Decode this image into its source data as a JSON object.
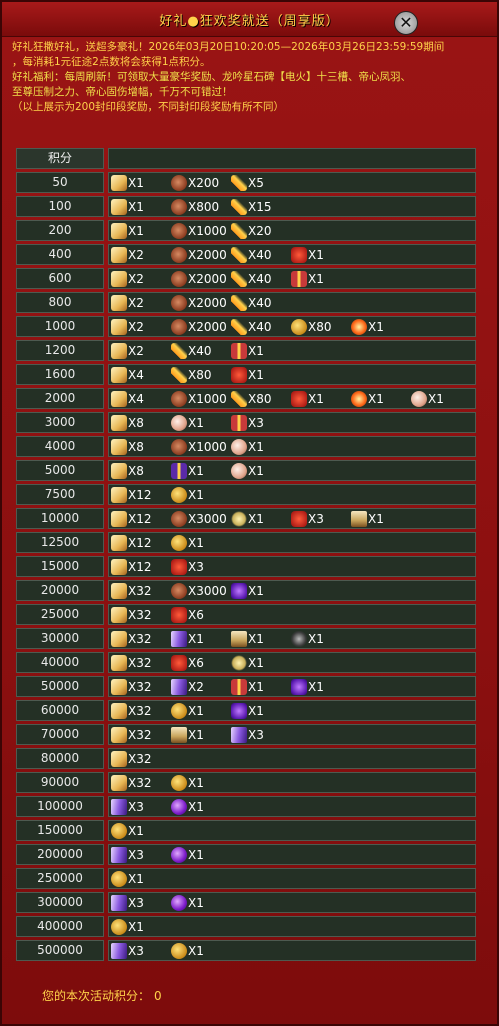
{
  "header": {
    "title": "好礼●狂欢奖就送（周享版）",
    "close_symbol": "✕"
  },
  "intro": {
    "line1": "好礼狂撒好礼，送超多豪礼！2026年03月20日10:20:05—2026年03月26日23:59:59期间",
    "line2": "，每消耗1元征途2点数将会获得1点积分。",
    "line3": "好礼福利：每周刷新！可领取大量豪华奖励、龙吟星石碑【电火】十三槽、帝心凤羽、",
    "line4": "至尊压制之力、帝心固伤增幅，千万不可错过！",
    "line5": "（以上展示为200封印段奖励，不同封印段奖励有所不同）"
  },
  "table": {
    "header": "积分",
    "rows": [
      {
        "score": "50",
        "items": [
          {
            "icon": "scroll-icon",
            "qty": "X1"
          },
          {
            "icon": "stone-icon",
            "qty": "X200"
          },
          {
            "icon": "feather-icon",
            "qty": "X5"
          }
        ]
      },
      {
        "score": "100",
        "items": [
          {
            "icon": "scroll-icon",
            "qty": "X1"
          },
          {
            "icon": "stone-icon",
            "qty": "X800"
          },
          {
            "icon": "feather-icon",
            "qty": "X15"
          }
        ]
      },
      {
        "score": "200",
        "items": [
          {
            "icon": "scroll-icon",
            "qty": "X1"
          },
          {
            "icon": "stone-icon",
            "qty": "X1000"
          },
          {
            "icon": "feather-icon",
            "qty": "X20"
          }
        ]
      },
      {
        "score": "400",
        "items": [
          {
            "icon": "scroll-icon",
            "qty": "X2"
          },
          {
            "icon": "stone-icon",
            "qty": "X2000"
          },
          {
            "icon": "feather-icon",
            "qty": "X40"
          },
          {
            "icon": "redbox-icon",
            "qty": "X1"
          }
        ]
      },
      {
        "score": "600",
        "items": [
          {
            "icon": "scroll-icon",
            "qty": "X2"
          },
          {
            "icon": "stone-icon",
            "qty": "X2000"
          },
          {
            "icon": "feather-icon",
            "qty": "X40"
          },
          {
            "icon": "giftbox-icon",
            "qty": "X1"
          }
        ]
      },
      {
        "score": "800",
        "items": [
          {
            "icon": "scroll-icon",
            "qty": "X2"
          },
          {
            "icon": "stone-icon",
            "qty": "X2000"
          },
          {
            "icon": "feather-icon",
            "qty": "X40"
          }
        ]
      },
      {
        "score": "1000",
        "items": [
          {
            "icon": "scroll-icon",
            "qty": "X2"
          },
          {
            "icon": "stone-icon",
            "qty": "X2000"
          },
          {
            "icon": "feather-icon",
            "qty": "X40"
          },
          {
            "icon": "coin-icon",
            "qty": "X80"
          },
          {
            "icon": "orb-icon",
            "qty": "X1"
          }
        ]
      },
      {
        "score": "1200",
        "items": [
          {
            "icon": "scroll-icon",
            "qty": "X2"
          },
          {
            "icon": "feather-icon",
            "qty": "X40"
          },
          {
            "icon": "giftbox-icon",
            "qty": "X1"
          }
        ]
      },
      {
        "score": "1600",
        "items": [
          {
            "icon": "scroll-icon",
            "qty": "X4"
          },
          {
            "icon": "feather-icon",
            "qty": "X80"
          },
          {
            "icon": "redbox-icon",
            "qty": "X1"
          }
        ]
      },
      {
        "score": "2000",
        "items": [
          {
            "icon": "scroll-icon",
            "qty": "X4"
          },
          {
            "icon": "stone-icon",
            "qty": "X1000"
          },
          {
            "icon": "feather-icon",
            "qty": "X80"
          },
          {
            "icon": "redbox-icon",
            "qty": "X1"
          },
          {
            "icon": "orb-icon",
            "qty": "X1"
          },
          {
            "icon": "pearl-icon",
            "qty": "X1"
          }
        ]
      },
      {
        "score": "3000",
        "items": [
          {
            "icon": "scroll-icon",
            "qty": "X8"
          },
          {
            "icon": "pearl-icon",
            "qty": "X1"
          },
          {
            "icon": "giftbox-icon",
            "qty": "X3"
          }
        ]
      },
      {
        "score": "4000",
        "items": [
          {
            "icon": "scroll-icon",
            "qty": "X8"
          },
          {
            "icon": "stone-icon",
            "qty": "X1000"
          },
          {
            "icon": "pearl-icon",
            "qty": "X1"
          }
        ]
      },
      {
        "score": "5000",
        "items": [
          {
            "icon": "scroll-icon",
            "qty": "X8"
          },
          {
            "icon": "purplegift-icon",
            "qty": "X1"
          },
          {
            "icon": "pearl-icon",
            "qty": "X1"
          }
        ]
      },
      {
        "score": "7500",
        "items": [
          {
            "icon": "scroll-icon",
            "qty": "X12"
          },
          {
            "icon": "coin-icon",
            "qty": "X1"
          }
        ]
      },
      {
        "score": "10000",
        "items": [
          {
            "icon": "scroll-icon",
            "qty": "X12"
          },
          {
            "icon": "stone-icon",
            "qty": "X3000"
          },
          {
            "icon": "star-icon",
            "qty": "X1"
          },
          {
            "icon": "redbox-icon",
            "qty": "X3"
          },
          {
            "icon": "chest-icon",
            "qty": "X1"
          }
        ]
      },
      {
        "score": "12500",
        "items": [
          {
            "icon": "scroll-icon",
            "qty": "X12"
          },
          {
            "icon": "coin-icon",
            "qty": "X1"
          }
        ]
      },
      {
        "score": "15000",
        "items": [
          {
            "icon": "scroll-icon",
            "qty": "X12"
          },
          {
            "icon": "redbox-icon",
            "qty": "X3"
          }
        ]
      },
      {
        "score": "20000",
        "items": [
          {
            "icon": "scroll-icon",
            "qty": "X32"
          },
          {
            "icon": "stone-icon",
            "qty": "X3000"
          },
          {
            "icon": "purplebox-icon",
            "qty": "X1"
          }
        ]
      },
      {
        "score": "25000",
        "items": [
          {
            "icon": "scroll-icon",
            "qty": "X32"
          },
          {
            "icon": "redbox-icon",
            "qty": "X6"
          }
        ]
      },
      {
        "score": "30000",
        "items": [
          {
            "icon": "scroll-icon",
            "qty": "X32"
          },
          {
            "icon": "talisman-icon",
            "qty": "X1"
          },
          {
            "icon": "chest-icon",
            "qty": "X1"
          },
          {
            "icon": "blackitem-icon",
            "qty": "X1"
          }
        ]
      },
      {
        "score": "40000",
        "items": [
          {
            "icon": "scroll-icon",
            "qty": "X32"
          },
          {
            "icon": "redbox-icon",
            "qty": "X6"
          },
          {
            "icon": "star-icon",
            "qty": "X1"
          }
        ]
      },
      {
        "score": "50000",
        "items": [
          {
            "icon": "scroll-icon",
            "qty": "X32"
          },
          {
            "icon": "talisman-icon",
            "qty": "X2"
          },
          {
            "icon": "giftbox-icon",
            "qty": "X1"
          },
          {
            "icon": "purplebox-icon",
            "qty": "X1"
          }
        ]
      },
      {
        "score": "60000",
        "items": [
          {
            "icon": "scroll-icon",
            "qty": "X32"
          },
          {
            "icon": "coin-icon",
            "qty": "X1"
          },
          {
            "icon": "purplebox-icon",
            "qty": "X1"
          }
        ]
      },
      {
        "score": "70000",
        "items": [
          {
            "icon": "scroll-icon",
            "qty": "X32"
          },
          {
            "icon": "chest-icon",
            "qty": "X1"
          },
          {
            "icon": "talisman-icon",
            "qty": "X3"
          }
        ]
      },
      {
        "score": "80000",
        "items": [
          {
            "icon": "scroll-icon",
            "qty": "X32"
          }
        ]
      },
      {
        "score": "90000",
        "items": [
          {
            "icon": "scroll-icon",
            "qty": "X32"
          },
          {
            "icon": "coin-icon",
            "qty": "X1"
          }
        ]
      },
      {
        "score": "100000",
        "items": [
          {
            "icon": "talisman-icon",
            "qty": "X3"
          },
          {
            "icon": "purpleorb-icon",
            "qty": "X1"
          }
        ]
      },
      {
        "score": "150000",
        "items": [
          {
            "icon": "coin-icon",
            "qty": "X1"
          }
        ]
      },
      {
        "score": "200000",
        "items": [
          {
            "icon": "talisman-icon",
            "qty": "X3"
          },
          {
            "icon": "purpleorb-icon",
            "qty": "X1"
          }
        ]
      },
      {
        "score": "250000",
        "items": [
          {
            "icon": "coin-icon",
            "qty": "X1"
          }
        ]
      },
      {
        "score": "300000",
        "items": [
          {
            "icon": "talisman-icon",
            "qty": "X3"
          },
          {
            "icon": "purpleorb-icon",
            "qty": "X1"
          }
        ]
      },
      {
        "score": "400000",
        "items": [
          {
            "icon": "coin-icon",
            "qty": "X1"
          }
        ]
      },
      {
        "score": "500000",
        "items": [
          {
            "icon": "talisman-icon",
            "qty": "X3"
          },
          {
            "icon": "coin-icon",
            "qty": "X1"
          }
        ]
      }
    ]
  },
  "footer": {
    "label": "您的本次活动积分：",
    "value": "0"
  }
}
